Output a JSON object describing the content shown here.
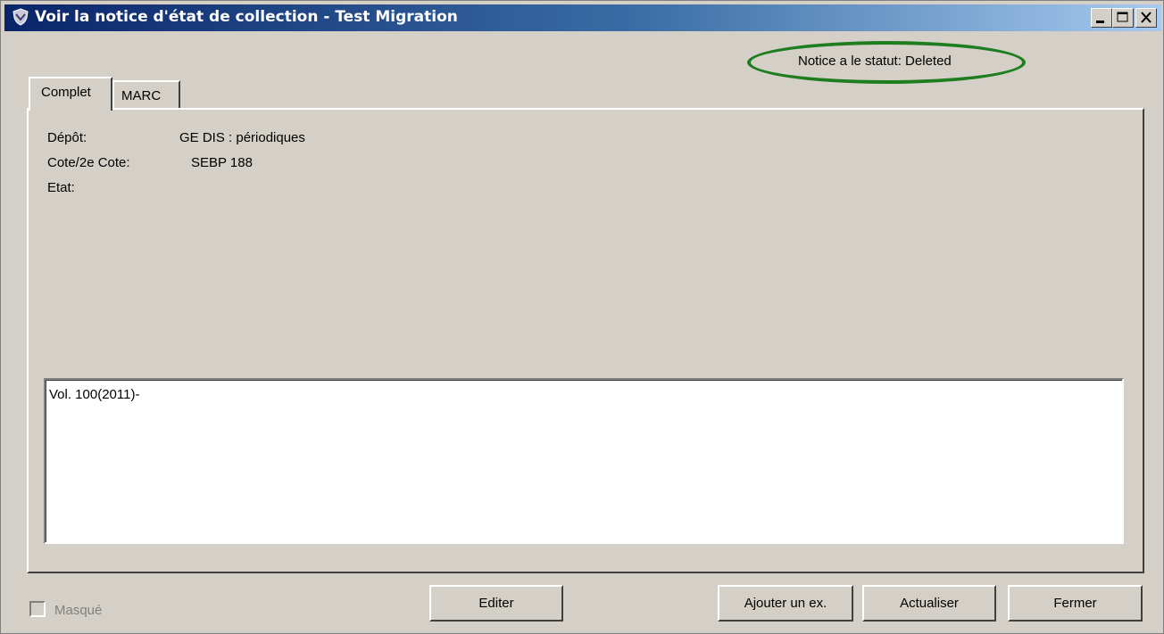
{
  "window": {
    "title": "Voir la notice d'état de collection - Test Migration",
    "controls": [
      "minimize-icon",
      "maximize-icon",
      "close-icon"
    ]
  },
  "status": {
    "text": "Notice a le statut: Deleted",
    "highlight_color": "#1e7d1e"
  },
  "tabs": [
    {
      "label": "Complet",
      "active": true
    },
    {
      "label": "MARC",
      "active": false
    }
  ],
  "fields": [
    {
      "label": "Dépôt:",
      "value": "GE DIS : périodiques"
    },
    {
      "label": "Cote/2e Cote:",
      "value": "SEBP 188"
    },
    {
      "label": "Etat:",
      "value": ""
    }
  ],
  "holdings_text": "Vol. 100(2011)-",
  "footer": {
    "checkbox_label": "Masqué",
    "checkbox_checked": false,
    "buttons": {
      "edit": "Editer",
      "add_item": "Ajouter un ex.",
      "refresh": "Actualiser",
      "close": "Fermer"
    }
  }
}
